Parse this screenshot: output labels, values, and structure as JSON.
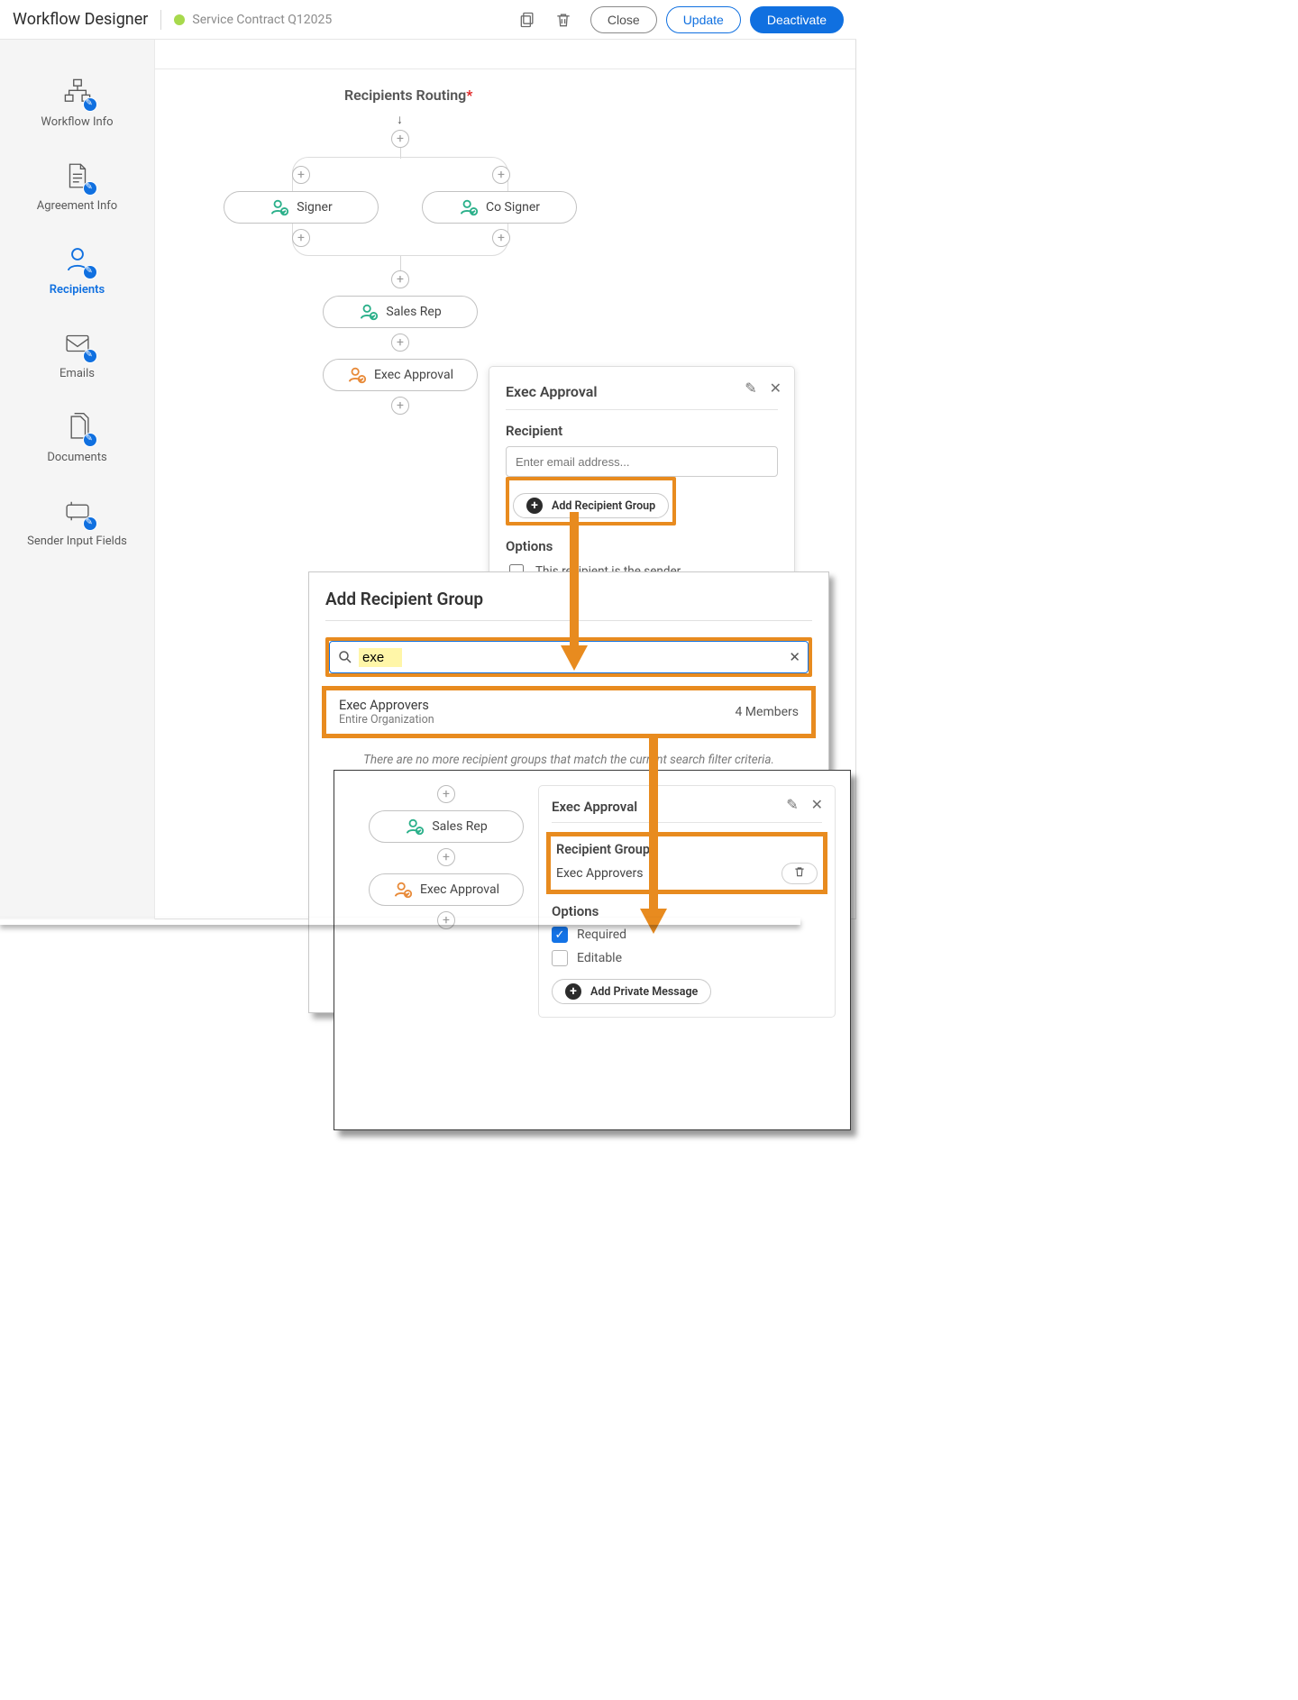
{
  "header": {
    "app_title": "Workflow Designer",
    "document_title": "Service Contract Q12025",
    "close_label": "Close",
    "update_label": "Update",
    "deactivate_label": "Deactivate"
  },
  "sidebar": {
    "items": [
      {
        "label": "Workflow Info"
      },
      {
        "label": "Agreement Info"
      },
      {
        "label": "Recipients"
      },
      {
        "label": "Emails"
      },
      {
        "label": "Documents"
      },
      {
        "label": "Sender Input Fields"
      }
    ]
  },
  "routing": {
    "title": "Recipients Routing",
    "required_marker": "*",
    "nodes": {
      "signer": "Signer",
      "cosigner": "Co Signer",
      "sales_rep": "Sales Rep",
      "exec_approval": "Exec Approval"
    }
  },
  "panel_recipient": {
    "title": "Exec Approval",
    "recipient_label": "Recipient",
    "email_placeholder": "Enter email address...",
    "add_group_label": "Add Recipient Group",
    "options_label": "Options",
    "opt_is_sender": "This recipient is the sender"
  },
  "dialog_add_group": {
    "title": "Add Recipient Group",
    "search_value": "exe",
    "result_name": "Exec Approvers",
    "result_scope": "Entire Organization",
    "result_members": "4 Members",
    "no_more": "There are no more recipient groups that match the current search filter criteria."
  },
  "panel_recipient_group": {
    "title": "Exec Approval",
    "group_label": "Recipient Group",
    "group_name": "Exec Approvers",
    "options_label": "Options",
    "opt_required": "Required",
    "opt_editable": "Editable",
    "add_private_msg": "Add Private Message"
  },
  "mini_routing": {
    "sales_rep": "Sales Rep",
    "exec_approval": "Exec Approval"
  }
}
